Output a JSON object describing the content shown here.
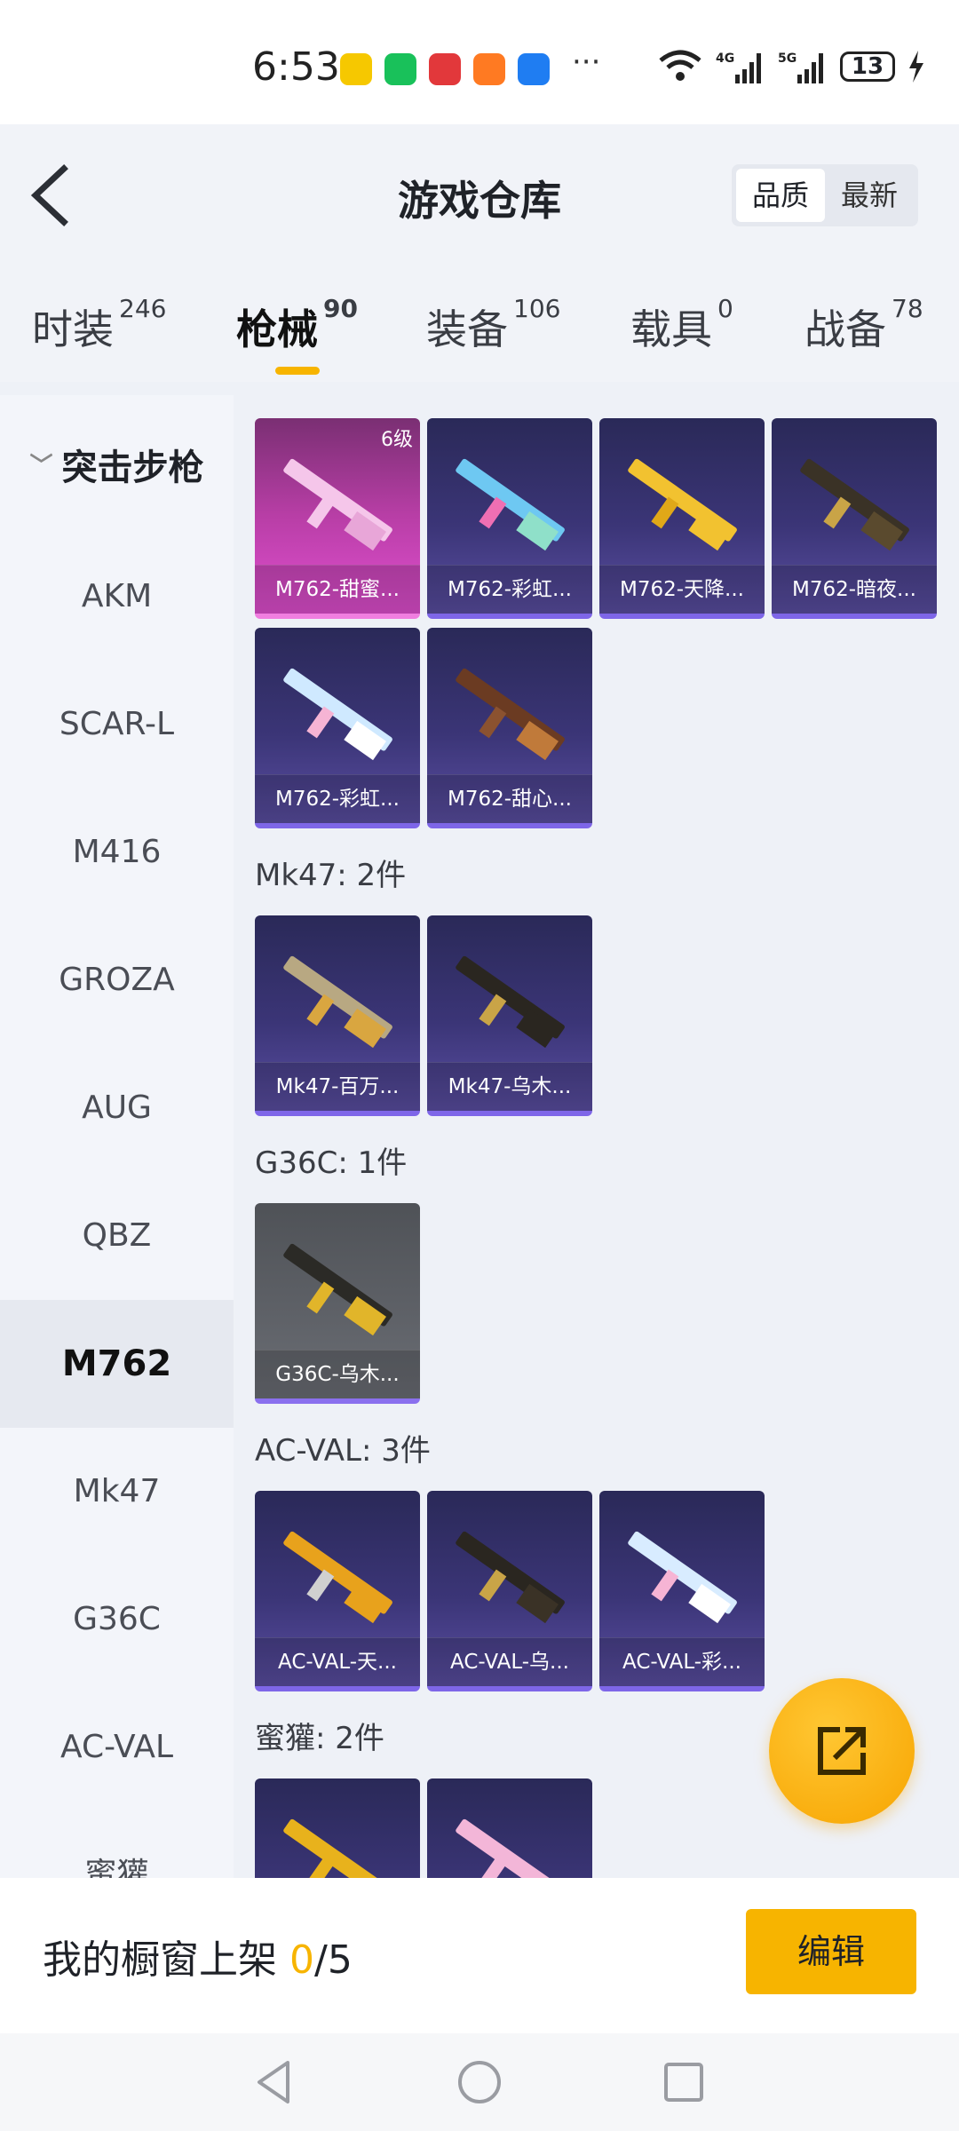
{
  "status_bar": {
    "time": "6:53",
    "battery": "13",
    "more": "···"
  },
  "header": {
    "title": "游戏仓库",
    "sort_options": [
      "品质",
      "最新"
    ]
  },
  "tabs": [
    {
      "label": "时装",
      "count": "246"
    },
    {
      "label": "枪械",
      "count": "90"
    },
    {
      "label": "装备",
      "count": "106"
    },
    {
      "label": "载具",
      "count": "0"
    },
    {
      "label": "战备",
      "count": "78"
    }
  ],
  "sidebar": {
    "group": "突击步枪",
    "items": [
      "AKM",
      "SCAR-L",
      "M416",
      "GROZA",
      "AUG",
      "QBZ",
      "M762",
      "Mk47",
      "G36C",
      "AC-VAL",
      "蜜獾"
    ]
  },
  "content": {
    "m762": [
      {
        "name": "M762-甜蜜...",
        "level": "6级"
      },
      {
        "name": "M762-彩虹..."
      },
      {
        "name": "M762-天降..."
      },
      {
        "name": "M762-暗夜..."
      },
      {
        "name": "M762-彩虹..."
      },
      {
        "name": "M762-甜心..."
      }
    ],
    "mk47_label": "Mk47: 2件",
    "mk47": [
      {
        "name": "Mk47-百万..."
      },
      {
        "name": "Mk47-乌木..."
      }
    ],
    "g36c_label": "G36C: 1件",
    "g36c": [
      {
        "name": "G36C-乌木..."
      }
    ],
    "acval_label": "AC-VAL: 3件",
    "acval": [
      {
        "name": "AC-VAL-天..."
      },
      {
        "name": "AC-VAL-乌..."
      },
      {
        "name": "AC-VAL-彩..."
      }
    ],
    "honey_label": "蜜獾: 2件"
  },
  "bottom": {
    "showcase_label": "我的橱窗上架 ",
    "current": "0",
    "total": "/5",
    "edit": "编辑"
  },
  "colors": {
    "accent": "#f7b400",
    "card_purple": "#3b3577",
    "card_pink": "#e04fd0"
  }
}
